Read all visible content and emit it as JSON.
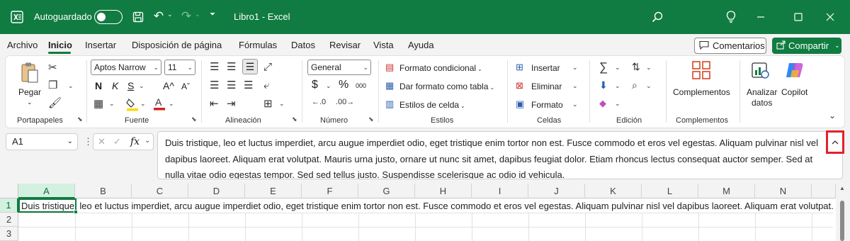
{
  "titlebar": {
    "autosave_label": "Autoguardado",
    "doc_title": "Libro1  -  Excel",
    "icons": [
      "excel-logo-icon",
      "save-icon",
      "undo-icon",
      "redo-icon",
      "customize-qat-icon",
      "search-icon",
      "lightbulb-icon",
      "minimize-icon",
      "maximize-icon",
      "close-icon"
    ]
  },
  "menu": {
    "tabs": [
      "Archivo",
      "Inicio",
      "Insertar",
      "Disposición de página",
      "Fórmulas",
      "Datos",
      "Revisar",
      "Vista",
      "Ayuda"
    ],
    "active": "Inicio",
    "comments_label": "Comentarios",
    "share_label": "Compartir"
  },
  "ribbon": {
    "groups": {
      "portapapeles": "Portapapeles",
      "fuente": "Fuente",
      "alineacion": "Alineación",
      "numero": "Número",
      "estilos": "Estilos",
      "celdas": "Celdas",
      "edicion": "Edición",
      "complementos": "Complementos"
    },
    "paste_label": "Pegar",
    "font_name": "Aptos Narrow",
    "font_size": "11",
    "bold": "N",
    "italic": "K",
    "underline": "S",
    "grow_font": "A^",
    "shrink_font": "Aˇ",
    "number_format": "General",
    "currency": "$",
    "percent": "%",
    "thousands": "000",
    "conditional_format": "Formato condicional",
    "format_as_table": "Dar formato como tabla",
    "cell_styles": "Estilos de celda",
    "insert": "Insertar",
    "delete": "Eliminar",
    "format": "Formato",
    "addins_label": "Complementos",
    "analyze_label_1": "Analizar",
    "analyze_label_2": "datos",
    "copilot_label": "Copilot"
  },
  "formula_bar": {
    "name_box": "A1",
    "fx": "fx",
    "content": "Duis tristique, leo et luctus imperdiet, arcu augue imperdiet odio, eget tristique enim tortor non est. Fusce commodo et eros vel egestas. Aliquam pulvinar nisl vel dapibus laoreet. Aliquam erat volutpat. Mauris urna justo, ornare ut nunc sit amet, dapibus feugiat dolor. Etiam rhoncus lectus consequat auctor semper. Sed at nulla vitae odio egestas tempor. Sed sed tellus justo. Suspendisse scelerisque ac odio id vehicula."
  },
  "grid": {
    "columns": [
      "A",
      "B",
      "C",
      "D",
      "E",
      "F",
      "G",
      "H",
      "I",
      "J",
      "K",
      "L",
      "M",
      "N"
    ],
    "rows": [
      "1",
      "2",
      "3"
    ],
    "cell_a1": "Duis tristique, leo et luctus imperdiet, arcu augue imperdiet odio, eget tristique enim tortor non est. Fusce commodo et eros vel egestas. Aliquam pulvinar nisl vel dapibus laoreet. Aliquam erat volutpat."
  },
  "colors": {
    "brand": "#107c41",
    "highlight": "#e4202b"
  }
}
